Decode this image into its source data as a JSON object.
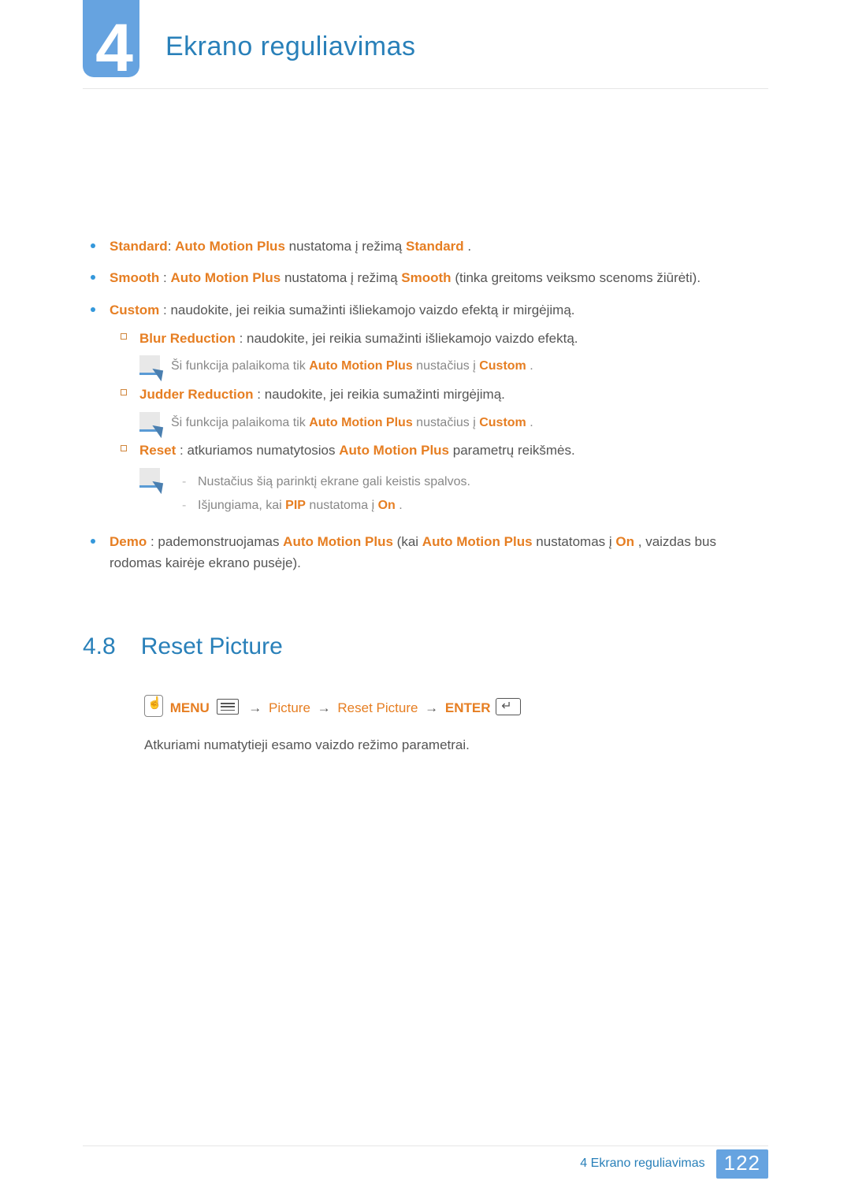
{
  "header": {
    "chapter_number": "4",
    "chapter_title": "Ekrano reguliavimas"
  },
  "bullets": {
    "standard": {
      "label": "Standard",
      "feature": "Auto Motion Plus",
      "mid": " nustatoma į režimą ",
      "mode": "Standard",
      "tail": "."
    },
    "smooth": {
      "label": "Smooth",
      "feature": "Auto Motion Plus",
      "mid": " nustatoma į režimą ",
      "mode": "Smooth",
      "tail": " (tinka greitoms veiksmo scenoms žiūrėti)."
    },
    "custom": {
      "label": "Custom",
      "rest": ": naudokite, jei reikia sumažinti išliekamojo vaizdo efektą ir mirgėjimą.",
      "blur": {
        "label": "Blur Reduction",
        "rest": ": naudokite, jei reikia sumažinti išliekamojo vaizdo efektą.",
        "note_pre": "Ši funkcija palaikoma tik ",
        "note_feat": "Auto Motion Plus",
        "note_mid": " nustačius į ",
        "note_mode": "Custom",
        "note_tail": "."
      },
      "judder": {
        "label": "Judder Reduction",
        "rest": ": naudokite, jei reikia sumažinti mirgėjimą.",
        "note_pre": "Ši funkcija palaikoma tik ",
        "note_feat": "Auto Motion Plus",
        "note_mid": " nustačius į ",
        "note_mode": "Custom",
        "note_tail": "."
      },
      "reset": {
        "label": "Reset",
        "pre": ": atkuriamos numatytosios ",
        "feat": "Auto Motion Plus",
        "tail": " parametrų reikšmės.",
        "note1": "Nustačius šią parinktį ekrane gali keistis spalvos.",
        "note2_pre": "Išjungiama, kai ",
        "note2_feat": "PIP",
        "note2_mid": " nustatoma į ",
        "note2_mode": "On",
        "note2_tail": "."
      }
    },
    "demo": {
      "label": "Demo",
      "pre": ": pademonstruojamas ",
      "feat1": "Auto Motion Plus",
      "mid1": " (kai ",
      "feat2": "Auto Motion Plus",
      "mid2": " nustatomas į ",
      "mode": "On",
      "tail": ", vaizdas bus rodomas kairėje ekrano pusėje)."
    }
  },
  "section": {
    "number": "4.8",
    "title": "Reset Picture"
  },
  "nav": {
    "menu": "MENU",
    "arrow": "→",
    "p1": "Picture",
    "p2": "Reset Picture",
    "enter": "ENTER"
  },
  "body": "Atkuriami numatytieji esamo vaizdo režimo parametrai.",
  "footer": {
    "label_num": "4",
    "label_text": " Ekrano reguliavimas",
    "page": "122"
  }
}
